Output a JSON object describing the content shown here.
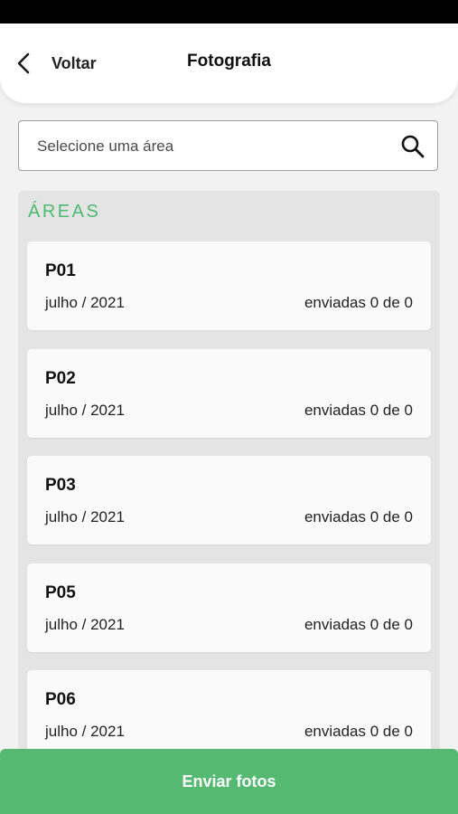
{
  "header": {
    "back_label": "Voltar",
    "title": "Fotografia"
  },
  "search": {
    "placeholder": "Selecione uma área"
  },
  "areas": {
    "section_title": "ÁREAS",
    "items": [
      {
        "name": "P01",
        "date": "julho / 2021",
        "status": "enviadas 0 de 0"
      },
      {
        "name": "P02",
        "date": "julho / 2021",
        "status": "enviadas 0 de 0"
      },
      {
        "name": "P03",
        "date": "julho / 2021",
        "status": "enviadas 0 de 0"
      },
      {
        "name": "P05",
        "date": "julho / 2021",
        "status": "enviadas 0 de 0"
      },
      {
        "name": "P06",
        "date": "julho / 2021",
        "status": "enviadas 0 de 0"
      }
    ]
  },
  "footer": {
    "submit_label": "Enviar fotos"
  },
  "colors": {
    "accent": "#56b972",
    "section_title": "#4dbb71",
    "status_bar": "#000000"
  }
}
